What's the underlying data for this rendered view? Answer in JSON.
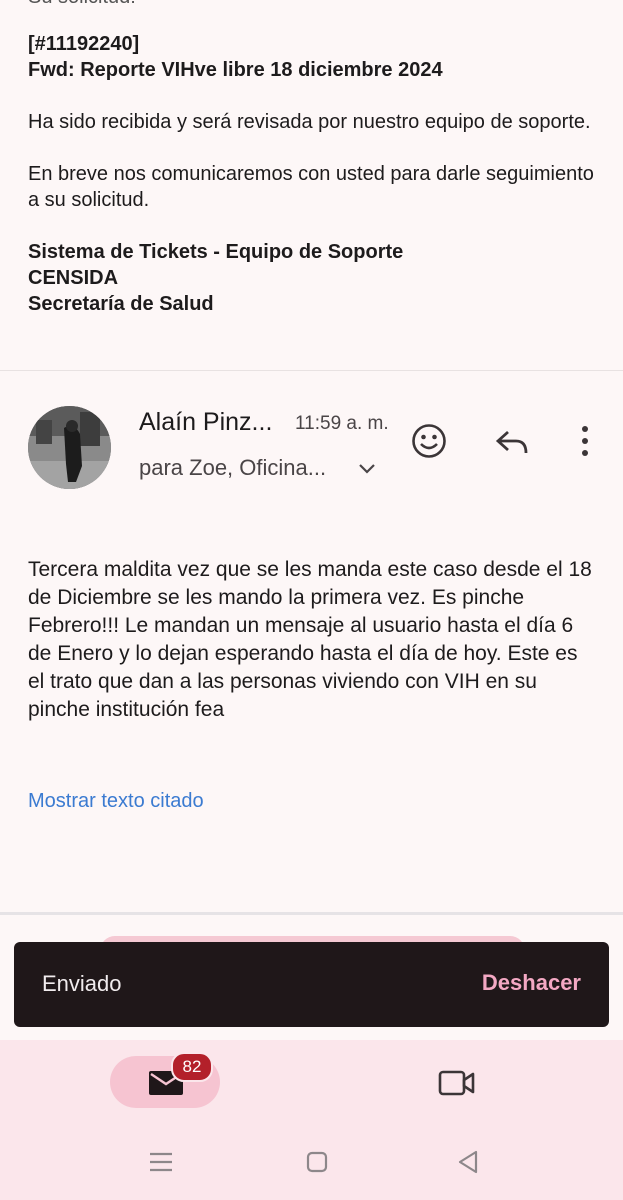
{
  "cut_text": "Su solicitud:",
  "ticket": {
    "id": "[#11192240]",
    "subject": "Fwd: Reporte VIHve libre 18 diciembre 2024",
    "line1": "Ha sido recibida y será revisada por nuestro equipo de soporte.",
    "line2": "En breve nos comunicaremos con usted para darle seguimiento a su solicitud.",
    "sig1": "Sistema de Tickets - Equipo de Soporte",
    "sig2": "CENSIDA",
    "sig3": "Secretaría de Salud"
  },
  "message": {
    "sender": "Alaín Pinz...",
    "time": "11:59 a. m.",
    "recipients": "para Zoe, Oficina...",
    "body": "Tercera maldita vez que se les manda este caso desde el 18 de Diciembre se les mando la primera vez. Es pinche Febrero!!! Le mandan un mensaje al usuario hasta el día 6 de Enero y lo dejan esperando hasta el día de hoy. Este es el trato que dan a las personas viviendo con VIH en su pinche institución fea",
    "show_quoted": "Mostrar texto citado"
  },
  "snackbar": {
    "text": "Enviado",
    "action": "Deshacer"
  },
  "nav": {
    "mail_badge": "82"
  },
  "icons": {
    "emoji": "emoji-icon",
    "reply": "reply-icon",
    "more": "more-vert-icon",
    "mail": "mail-icon",
    "meet": "video-icon"
  },
  "colors": {
    "link": "#3b7bd1",
    "snackbar_bg": "#1f1719",
    "snackbar_action": "#f3a8c3",
    "badge": "#b3202a",
    "nav_bg": "#fbe6eb"
  }
}
